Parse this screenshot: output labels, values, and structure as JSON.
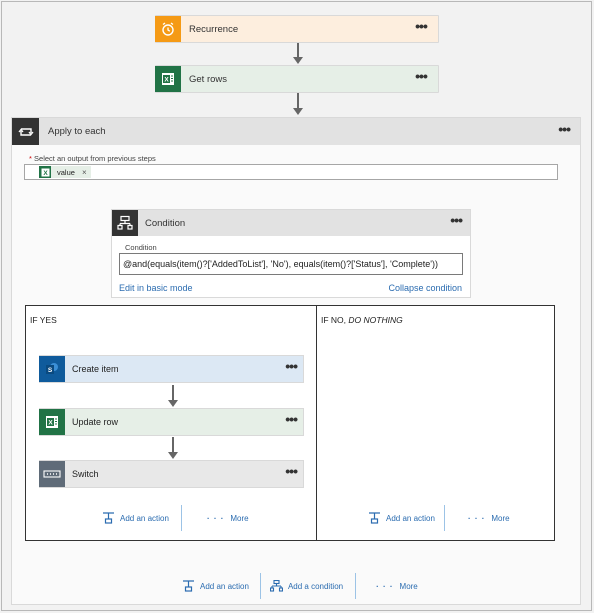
{
  "trigger": {
    "title": "Recurrence",
    "icon": "alarm-clock-icon",
    "more": "•••",
    "color": "#f59a15"
  },
  "get_rows": {
    "title": "Get rows",
    "icon": "excel-icon",
    "more": "•••",
    "color": "#217346"
  },
  "apply_to_each": {
    "title": "Apply to each",
    "icon": "loop-icon",
    "more": "•••",
    "select_label": "Select an output from previous steps",
    "required_mark": "*",
    "token": {
      "label": "value",
      "remove": "×"
    }
  },
  "condition": {
    "title": "Condition",
    "icon": "condition-icon",
    "more": "•••",
    "sub_label": "Condition",
    "expression": "@and(equals(item()?['AddedToList'], 'No'), equals(item()?['Status'], 'Complete'))",
    "edit_basic": "Edit in basic mode",
    "collapse": "Collapse condition"
  },
  "if_yes": {
    "title": "IF YES",
    "steps": [
      {
        "label": "Create item",
        "icon": "sharepoint-icon",
        "more": "•••",
        "color": "#0f5b9c"
      },
      {
        "label": "Update row",
        "icon": "excel-icon",
        "more": "•••",
        "color": "#217346"
      },
      {
        "label": "Switch",
        "icon": "switch-icon",
        "more": "•••",
        "color": "#5f6b78"
      }
    ],
    "add_action": "Add an action",
    "more": "More"
  },
  "if_no": {
    "title_prefix": "IF NO,",
    "title_italic": "DO NOTHING",
    "add_action": "Add an action",
    "more": "More"
  },
  "bottom": {
    "add_action": "Add an action",
    "add_condition": "Add a condition",
    "more": "More"
  }
}
